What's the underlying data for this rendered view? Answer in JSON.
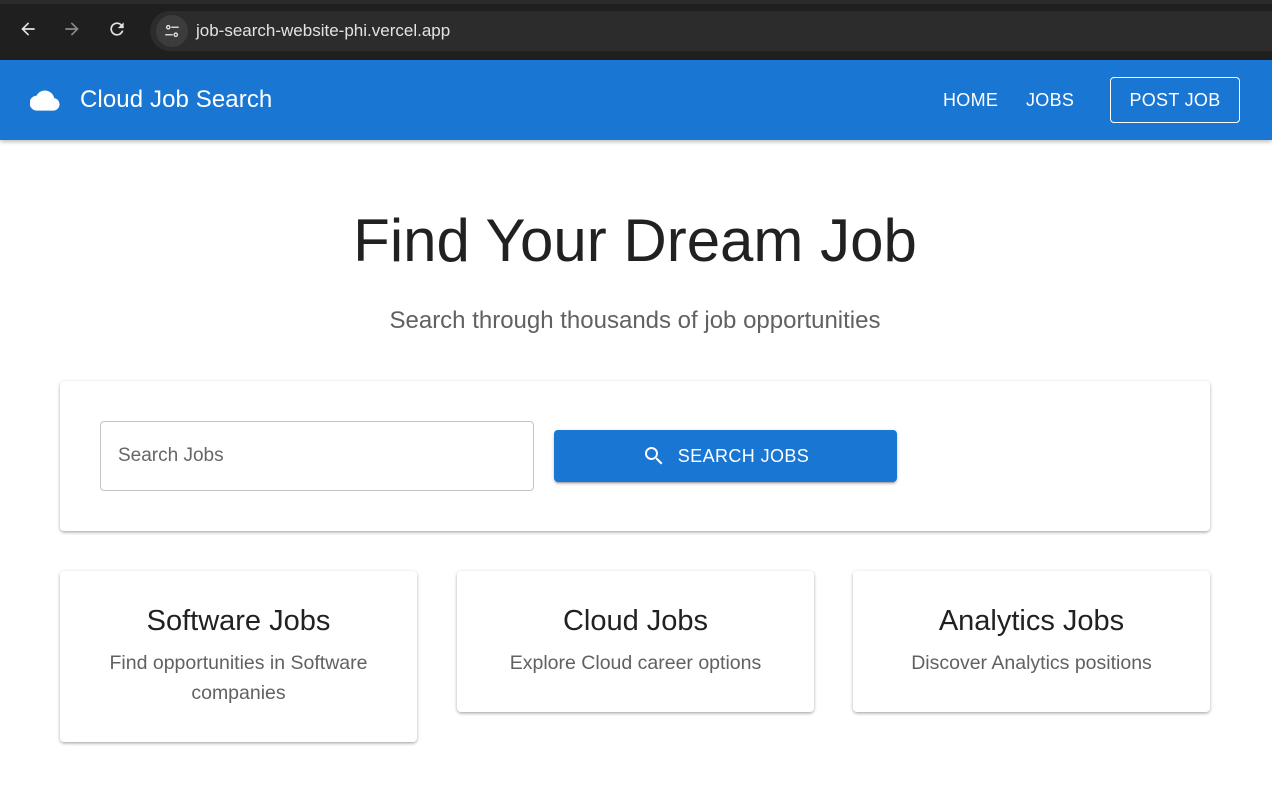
{
  "browser": {
    "url": "job-search-website-phi.vercel.app",
    "back_icon": "arrow-left-icon",
    "forward_icon": "arrow-right-icon",
    "reload_icon": "reload-icon",
    "site_info_icon": "tune-icon"
  },
  "app_bar": {
    "brand_icon": "cloud-icon",
    "title": "Cloud Job Search",
    "nav": {
      "home": "HOME",
      "jobs": "JOBS",
      "post_job": "POST JOB"
    },
    "color": "#1976d2"
  },
  "hero": {
    "title": "Find Your Dream Job",
    "subtitle": "Search through thousands of job opportunities"
  },
  "search": {
    "placeholder": "Search Jobs",
    "value": "",
    "button_label": "SEARCH JOBS",
    "button_icon": "search-icon"
  },
  "categories": [
    {
      "title": "Software Jobs",
      "description": "Find opportunities in Software companies"
    },
    {
      "title": "Cloud Jobs",
      "description": "Explore Cloud career options"
    },
    {
      "title": "Analytics Jobs",
      "description": "Discover Analytics positions"
    }
  ]
}
